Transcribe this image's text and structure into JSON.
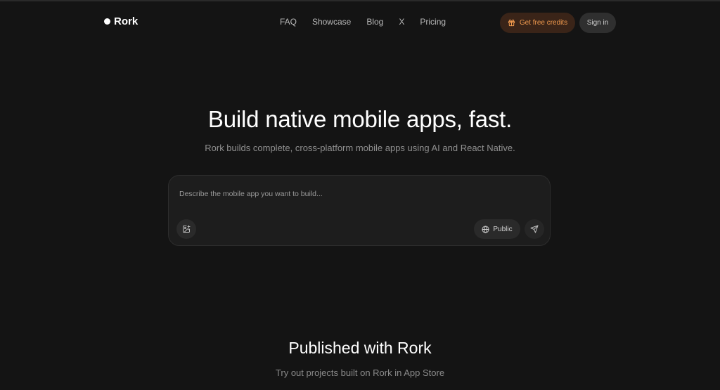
{
  "brand": {
    "name": "Rork"
  },
  "nav": {
    "links": [
      {
        "label": "FAQ"
      },
      {
        "label": "Showcase"
      },
      {
        "label": "Blog"
      },
      {
        "label": "X"
      },
      {
        "label": "Pricing"
      }
    ],
    "credits_label": "Get free credits",
    "signin_label": "Sign in"
  },
  "hero": {
    "title": "Build native mobile apps, fast.",
    "subtitle": "Rork builds complete, cross-platform mobile apps using AI and React Native."
  },
  "prompt": {
    "placeholder": "Describe the mobile app you want to build...",
    "value": "",
    "visibility_label": "Public",
    "attach_icon": "image-plus-icon",
    "visibility_icon": "globe-icon",
    "send_icon": "send-icon"
  },
  "published": {
    "title": "Published with Rork",
    "subtitle": "Try out projects built on Rork in App Store"
  },
  "colors": {
    "background": "#141414",
    "accent": "#f19a4e",
    "accent_bg": "#3a2418"
  }
}
